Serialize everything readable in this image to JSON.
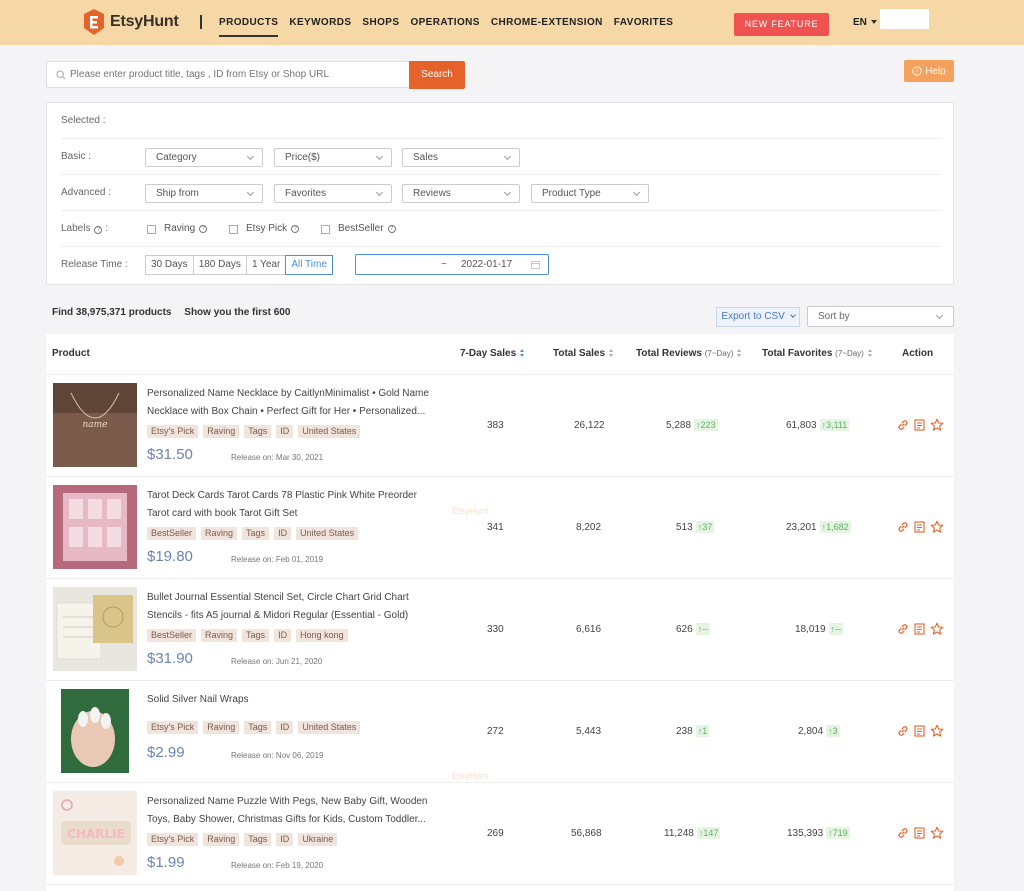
{
  "header": {
    "brand": "EtsyHunt",
    "nav": [
      "PRODUCTS",
      "KEYWORDS",
      "SHOPS",
      "OPERATIONS",
      "CHROME-EXTENSION",
      "FAVORITES"
    ],
    "new_feature": "NEW FEATURE",
    "lang": "EN"
  },
  "search": {
    "placeholder": "Please enter product title, tags , ID from Etsy or Shop URL",
    "button": "Search",
    "help": "Help"
  },
  "filters": {
    "selected_label": "Selected :",
    "basic_label": "Basic :",
    "basic": [
      "Category",
      "Price($)",
      "Sales"
    ],
    "advanced_label": "Advanced :",
    "advanced": [
      "Ship from",
      "Favorites",
      "Reviews",
      "Product Type"
    ],
    "labels_label": "Labels",
    "labels_suffix": ":",
    "labels": [
      "Raving",
      "Etsy Pick",
      "BestSeller"
    ],
    "release_label": "Release Time :",
    "release": [
      "30 Days",
      "180 Days",
      "1 Year",
      "All Time"
    ],
    "date_tilde": "~",
    "date_end": "2022-01-17"
  },
  "results": {
    "found": "Find 38,975,371 products",
    "showing": "Show you the first 600",
    "export": "Export to CSV",
    "sort_by": "Sort by"
  },
  "table": {
    "headers": {
      "product": "Product",
      "sales7": "7-Day Sales",
      "total_sales": "Total Sales",
      "reviews": "Total Reviews",
      "favorites": "Total Favorites",
      "period": "(7~Day)",
      "action": "Action"
    },
    "rows": [
      {
        "title": "Personalized Name Necklace by CaitlynMinimalist • Gold Name Necklace with Box Chain • Perfect Gift for Her • Personalized...",
        "tags": [
          "Etsy's Pick",
          "Raving",
          "Tags",
          "ID",
          "United States"
        ],
        "price": "$31.50",
        "release": "Release on: Mar 30, 2021",
        "sales7": "383",
        "total_sales": "26,122",
        "reviews": "5,288",
        "reviews_delta": "↑223",
        "favorites": "61,803",
        "favorites_delta": "↑3,111"
      },
      {
        "title": "Tarot Deck Cards Tarot Cards 78 Plastic Pink White Preorder Tarot card with book Tarot Gift Set",
        "tags": [
          "BestSeller",
          "Raving",
          "Tags",
          "ID",
          "United States"
        ],
        "price": "$19.80",
        "release": "Release on: Feb 01, 2019",
        "sales7": "341",
        "total_sales": "8,202",
        "reviews": "513",
        "reviews_delta": "↑37",
        "favorites": "23,201",
        "favorites_delta": "↑1,682"
      },
      {
        "title": "Bullet Journal Essential Stencil Set, Circle Chart Grid Chart Stencils - fits A5 journal & Midori Regular (Essential - Gold)",
        "tags": [
          "BestSeller",
          "Raving",
          "Tags",
          "ID",
          "Hong kong"
        ],
        "price": "$31.90",
        "release": "Release on: Jun 21, 2020",
        "sales7": "330",
        "total_sales": "6,616",
        "reviews": "626",
        "reviews_delta": "↑--",
        "favorites": "18,019",
        "favorites_delta": "↑--"
      },
      {
        "title": "Solid Silver Nail Wraps",
        "tags": [
          "Etsy's Pick",
          "Raving",
          "Tags",
          "ID",
          "United States"
        ],
        "price": "$2.99",
        "release": "Release on: Nov 06, 2019",
        "sales7": "272",
        "total_sales": "5,443",
        "reviews": "238",
        "reviews_delta": "↑1",
        "favorites": "2,804",
        "favorites_delta": "↑3"
      },
      {
        "title": "Personalized Name Puzzle With Pegs, New Baby Gift, Wooden Toys, Baby Shower, Christmas Gifts for Kids, Custom Toddler...",
        "tags": [
          "Etsy's Pick",
          "Raving",
          "Tags",
          "ID",
          "Ukraine"
        ],
        "price": "$1.99",
        "release": "Release on: Feb 19, 2020",
        "sales7": "269",
        "total_sales": "56,868",
        "reviews": "11,248",
        "reviews_delta": "↑147",
        "favorites": "135,393",
        "favorites_delta": "↑719"
      }
    ]
  },
  "watermark": "EtsyHunt"
}
